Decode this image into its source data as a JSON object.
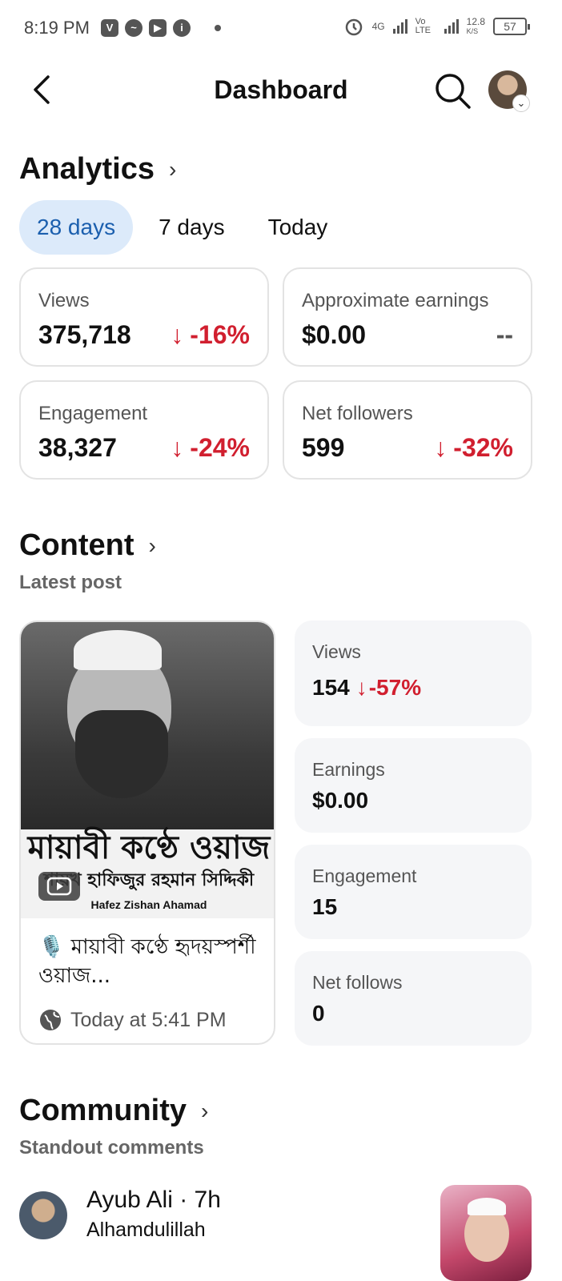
{
  "status_bar": {
    "time": "8:19 PM",
    "network": "4G",
    "volte": "Vo LTE",
    "speed": "12.8",
    "speed_unit": "K/S",
    "battery": "57"
  },
  "header": {
    "title": "Dashboard"
  },
  "analytics": {
    "title": "Analytics",
    "tabs": [
      {
        "label": "28 days",
        "active": true
      },
      {
        "label": "7 days",
        "active": false
      },
      {
        "label": "Today",
        "active": false
      }
    ],
    "cards": [
      {
        "label": "Views",
        "value": "375,718",
        "change": "-16%"
      },
      {
        "label": "Approximate earnings",
        "value": "$0.00",
        "change": "--"
      },
      {
        "label": "Engagement",
        "value": "38,327",
        "change": "-24%"
      },
      {
        "label": "Net followers",
        "value": "599",
        "change": "-32%"
      }
    ]
  },
  "content": {
    "title": "Content",
    "subtitle": "Latest post",
    "post": {
      "thumb_headline": "মায়াবী কণ্ঠে ওয়াজ",
      "thumb_sub": "শায়খ হাফিজুর রহমান সিদ্দিকী",
      "thumb_credit": "Hafez Zishan Ahamad",
      "caption": "🎙️ মায়াবী কণ্ঠে হৃদয়স্পর্শী ওয়াজ...",
      "time": "Today at 5:41 PM"
    },
    "stats": [
      {
        "label": "Views",
        "value": "154",
        "change": "-57%"
      },
      {
        "label": "Earnings",
        "value": "$0.00"
      },
      {
        "label": "Engagement",
        "value": "15"
      },
      {
        "label": "Net follows",
        "value": "0"
      }
    ]
  },
  "community": {
    "title": "Community",
    "subtitle": "Standout comments",
    "comment": {
      "author": "Ayub Ali · 7h",
      "text": "Alhamdulillah"
    }
  },
  "colors": {
    "accent": "#1b5fae",
    "tab_active_bg": "#dceafa",
    "negative": "#d11f2f"
  }
}
